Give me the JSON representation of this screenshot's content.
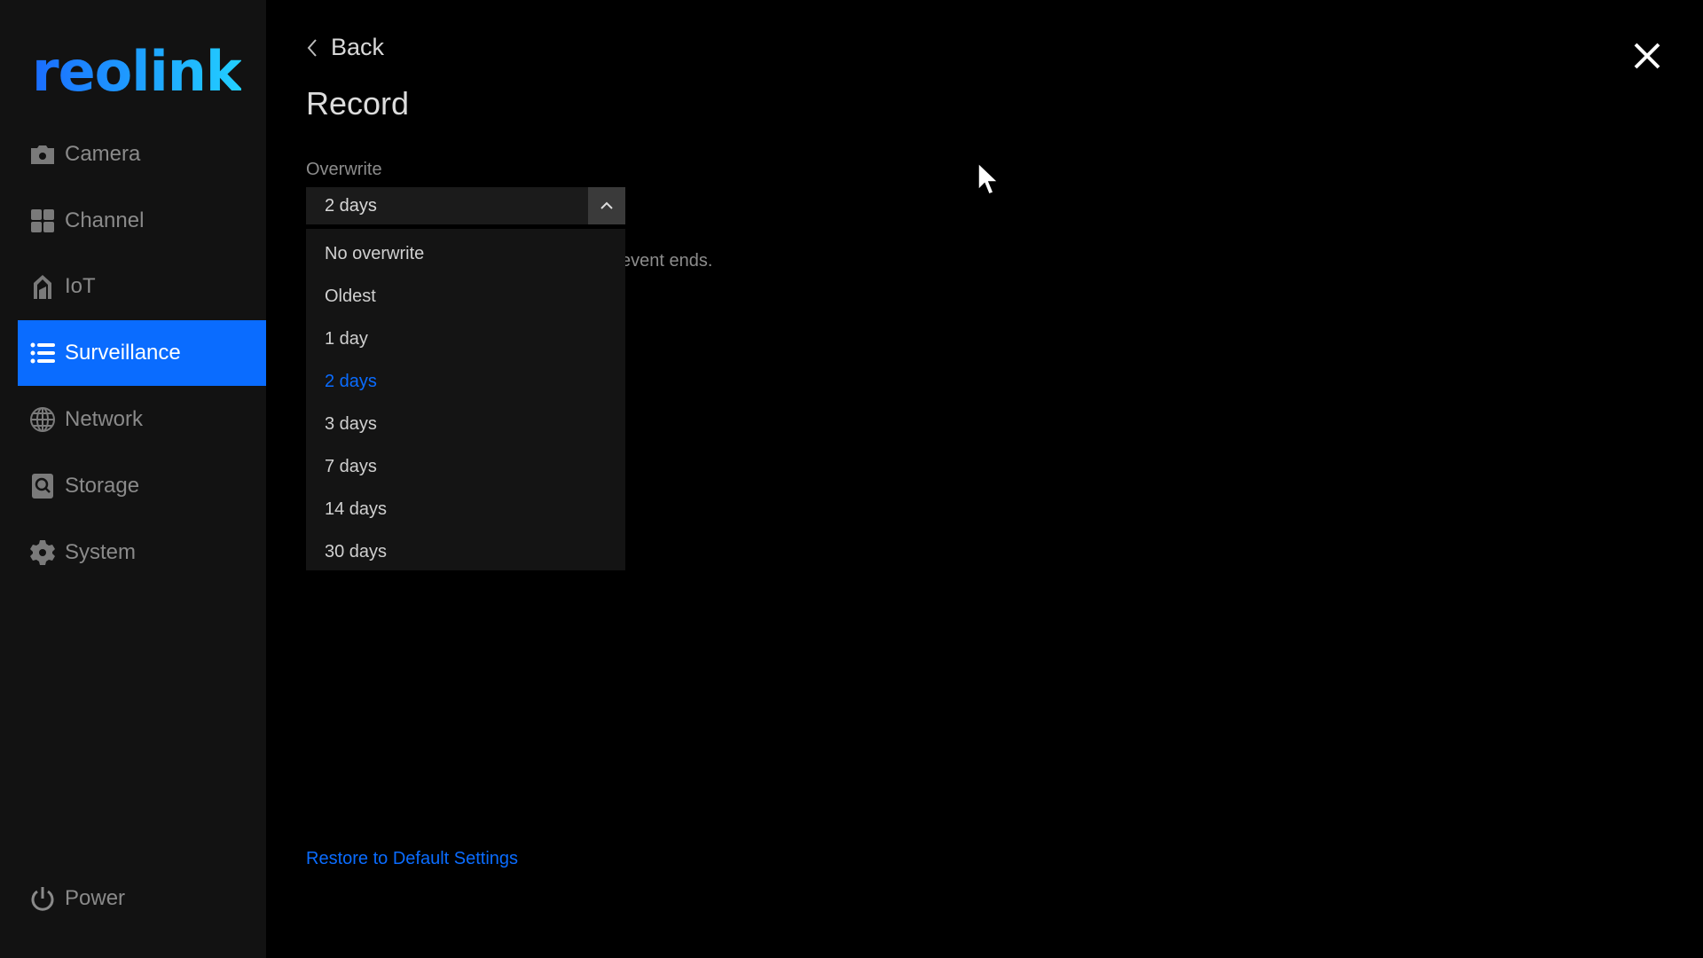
{
  "brand": {
    "logo": "reolink",
    "accent": "#0a6cff"
  },
  "sidebar": {
    "items": [
      {
        "label": "Camera",
        "icon": "camera-icon"
      },
      {
        "label": "Channel",
        "icon": "channel-grid-icon"
      },
      {
        "label": "IoT",
        "icon": "iot-house-icon"
      },
      {
        "label": "Surveillance",
        "icon": "list-icon",
        "active": true
      },
      {
        "label": "Network",
        "icon": "globe-icon"
      },
      {
        "label": "Storage",
        "icon": "storage-icon"
      },
      {
        "label": "System",
        "icon": "gear-icon"
      }
    ],
    "power": "Power"
  },
  "header": {
    "back": "Back",
    "title": "Record"
  },
  "overwrite": {
    "label": "Overwrite",
    "value": "2 days",
    "options": [
      "No overwrite",
      "Oldest",
      "1 day",
      "2 days",
      "3 days",
      "7 days",
      "14 days",
      "30 days"
    ],
    "selected_index": 3
  },
  "hint": "event ends.",
  "restore": "Restore to Default Settings"
}
